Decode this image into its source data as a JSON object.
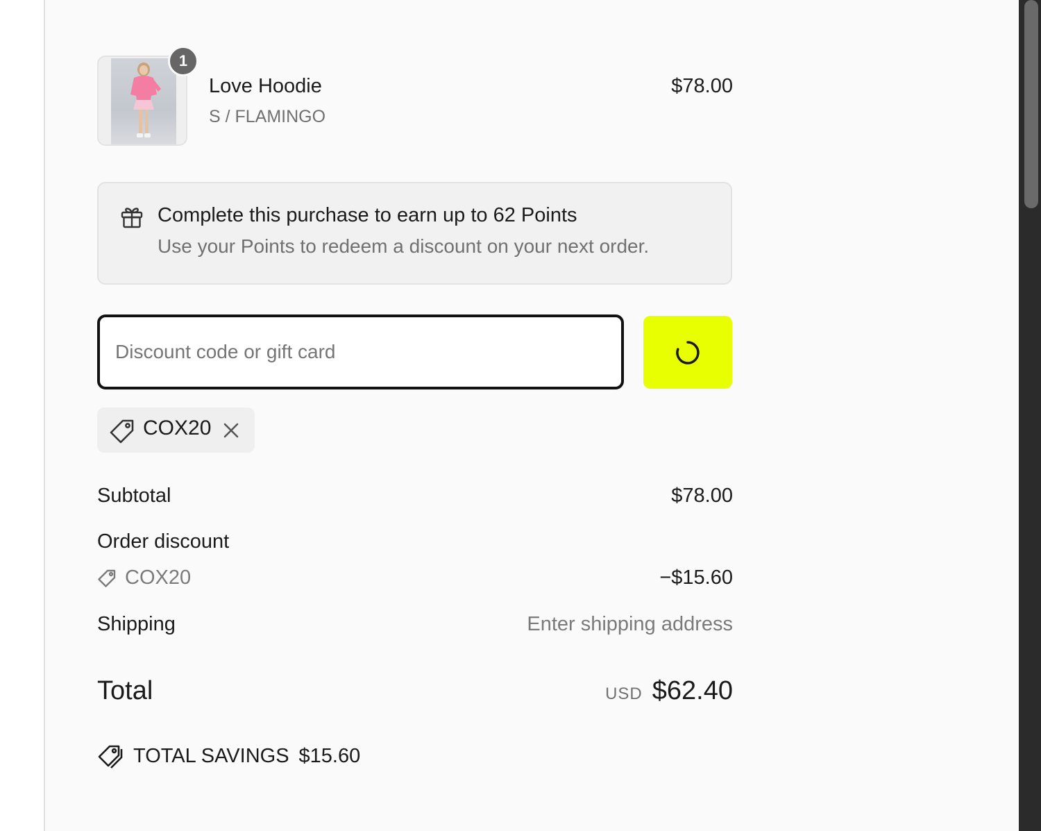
{
  "cart": {
    "items": [
      {
        "quantity_badge": "1",
        "name": "Love Hoodie",
        "variant": "S / FLAMINGO",
        "price": "$78.00"
      }
    ]
  },
  "rewards": {
    "title": "Complete this purchase to earn up to 62 Points",
    "subtitle": "Use your Points to redeem a discount on your next order."
  },
  "discount": {
    "placeholder": "Discount code or gift card",
    "value": "",
    "apply_state": "loading",
    "applied_code": "COX20"
  },
  "totals": {
    "subtotal_label": "Subtotal",
    "subtotal_value": "$78.00",
    "order_discount_label": "Order discount",
    "discount_code": "COX20",
    "discount_value": "−$15.60",
    "shipping_label": "Shipping",
    "shipping_value": "Enter shipping address",
    "total_label": "Total",
    "currency": "USD",
    "total_value": "$62.40",
    "savings_label": "TOTAL SAVINGS",
    "savings_value": "$15.60"
  },
  "colors": {
    "accent_button": "#e7ff00",
    "panel_background": "#fafafa",
    "badge_background": "#666666"
  },
  "icons": {
    "banner": "gift-icon",
    "chip": "tag-icon",
    "chip_remove": "close-icon",
    "apply": "spinner-icon",
    "savings": "tags-icon"
  }
}
